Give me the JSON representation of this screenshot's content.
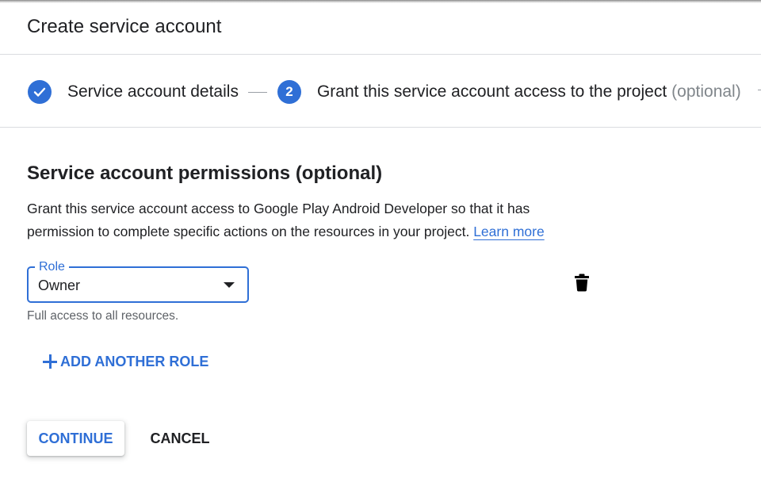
{
  "header": {
    "title": "Create service account"
  },
  "stepper": {
    "steps": [
      {
        "label": "Service account details",
        "state": "completed",
        "icon": "check-icon"
      },
      {
        "number": "2",
        "label": "Grant this service account access to the project",
        "optional": "(optional)",
        "state": "active"
      }
    ]
  },
  "permissions": {
    "title": "Service account permissions (optional)",
    "description": "Grant this service account access to Google Play Android Developer so that it has permission to complete specific actions on the resources in your project.",
    "learn_more": "Learn more",
    "role": {
      "label": "Role",
      "value": "Owner",
      "helper": "Full access to all resources."
    },
    "delete_icon": "trash-icon",
    "add_role": "ADD ANOTHER ROLE"
  },
  "actions": {
    "continue": "CONTINUE",
    "cancel": "CANCEL"
  },
  "colors": {
    "accent": "#2f6fd6",
    "text": "#202124",
    "secondary_text": "#5f6368",
    "divider": "#dadce0"
  }
}
